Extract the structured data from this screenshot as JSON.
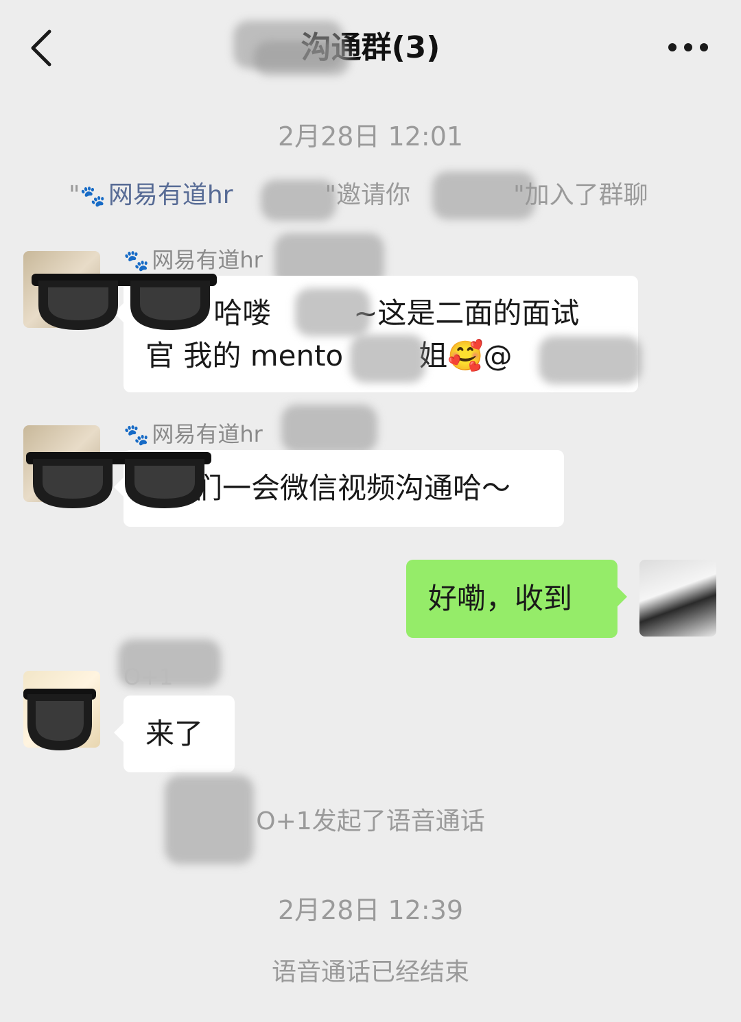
{
  "header": {
    "title": "沟通群(3)",
    "back_icon": "chevron-left-icon",
    "more_icon": "more-dots-icon"
  },
  "timestamps": {
    "first": "2月28日 12:01",
    "second": "2月28日 12:39"
  },
  "invite": {
    "quote_open": "\"",
    "inviter": "网易有道hr",
    "middle": "\"邀请你",
    "end": "\"加入了群聊"
  },
  "messages": [
    {
      "sender": "网易有道hr",
      "line1": "e 哈喽",
      "line1b": "~这是二面的面试",
      "line2a": "官 我的 mento",
      "line2b": "姐🥰@"
    },
    {
      "sender": "网易有道hr",
      "text": "们一会微信视频沟通哈～"
    },
    {
      "text": "好嘞，收到"
    },
    {
      "sender": "O+1",
      "text": "来了"
    }
  ],
  "system": {
    "voice_call_started": "O+1发起了语音通话",
    "voice_call_ended": "语音通话已经结束"
  },
  "colors": {
    "background": "#ededed",
    "my_bubble": "#95ec69",
    "link": "#576b95",
    "muted": "#9a9a9a"
  }
}
